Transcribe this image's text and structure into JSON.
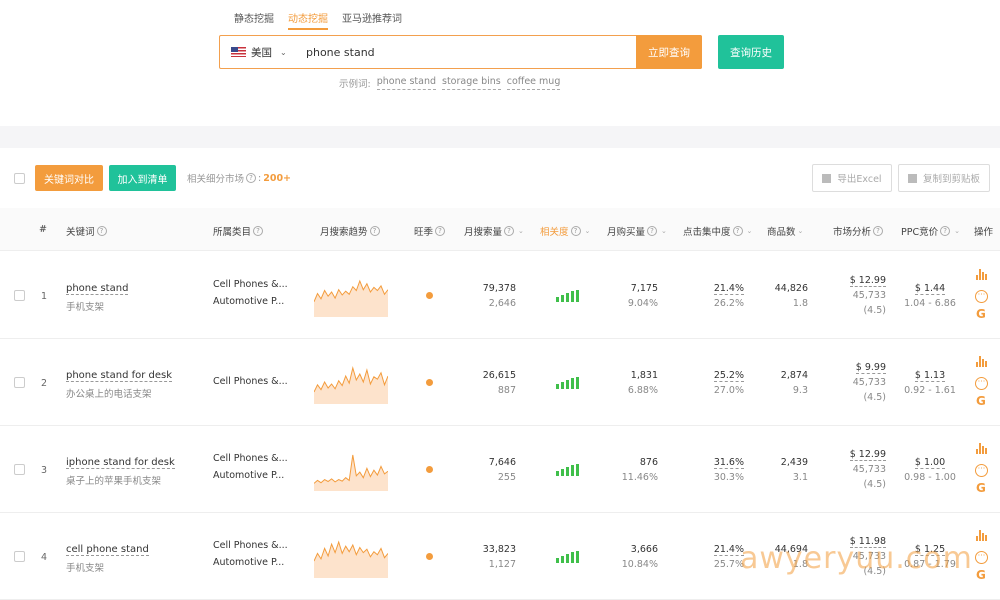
{
  "tabs": [
    "静态挖掘",
    "动态挖掘",
    "亚马逊推荐词"
  ],
  "search": {
    "country": "美国",
    "keyword": "phone stand",
    "search_button": "立即查询",
    "history_button": "查询历史",
    "examples_label": "示例词:",
    "examples": [
      "phone stand",
      "storage bins",
      "coffee mug"
    ]
  },
  "toolbar": {
    "compare_button": "关键词对比",
    "add_list_button": "加入到清单",
    "market_label": "相关细分市场",
    "market_count": "200+",
    "export_button": "导出Excel",
    "copy_button": "复制到剪贴板"
  },
  "table": {
    "headers": [
      "#",
      "关键词",
      "所属类目",
      "月搜索趋势",
      "旺季",
      "月搜索量",
      "相关度",
      "月购买量",
      "点击集中度",
      "商品数",
      "市场分析",
      "PPC竞价",
      "操作"
    ],
    "rows": [
      {
        "index": "1",
        "keyword": "phone stand",
        "keyword_cn": "手机支架",
        "cat1": "Cell Phones &...",
        "cat2": "Automotive P...",
        "search_vol": "79,378",
        "search_vol_sub": "2,646",
        "relevance": 5,
        "purchase": "7,175",
        "purchase_rate": "9.04%",
        "click": "21.4%",
        "click_sub": "26.2%",
        "products": "44,826",
        "products_sub": "1.8",
        "price": "$ 12.99",
        "reviews": "45,733",
        "rating": "(4.5)",
        "ppc": "$ 1.44",
        "ppc_range": "1.04 - 6.86",
        "trend": [
          40,
          62,
          48,
          70,
          55,
          66,
          50,
          72,
          58,
          68,
          60,
          80,
          70,
          95,
          72,
          88,
          66,
          78,
          70,
          82,
          60,
          72
        ]
      },
      {
        "index": "2",
        "keyword": "phone stand for desk",
        "keyword_cn": "办公桌上的电话支架",
        "cat1": "Cell Phones &...",
        "cat2": "",
        "search_vol": "26,615",
        "search_vol_sub": "887",
        "relevance": 5,
        "purchase": "1,831",
        "purchase_rate": "6.88%",
        "click": "25.2%",
        "click_sub": "27.0%",
        "products": "2,874",
        "products_sub": "9.3",
        "price": "$ 9.99",
        "reviews": "45,733",
        "rating": "(4.5)",
        "ppc": "$ 1.13",
        "ppc_range": "0.92 - 1.61",
        "trend": [
          30,
          48,
          36,
          55,
          40,
          50,
          38,
          58,
          46,
          70,
          52,
          90,
          60,
          75,
          55,
          85,
          50,
          68,
          62,
          78,
          48,
          70
        ]
      },
      {
        "index": "3",
        "keyword": "iphone stand for desk",
        "keyword_cn": "桌子上的苹果手机支架",
        "cat1": "Cell Phones &...",
        "cat2": "Automotive P...",
        "search_vol": "7,646",
        "search_vol_sub": "255",
        "relevance": 5,
        "purchase": "876",
        "purchase_rate": "11.46%",
        "click": "31.6%",
        "click_sub": "30.3%",
        "products": "2,439",
        "products_sub": "3.1",
        "price": "$ 12.99",
        "reviews": "45,733",
        "rating": "(4.5)",
        "ppc": "$ 1.00",
        "ppc_range": "0.98 - 1.00",
        "trend": [
          20,
          28,
          22,
          30,
          25,
          32,
          24,
          30,
          26,
          35,
          28,
          95,
          40,
          50,
          35,
          60,
          38,
          55,
          42,
          65,
          45,
          52
        ]
      },
      {
        "index": "4",
        "keyword": "cell phone stand",
        "keyword_cn": "手机支架",
        "cat1": "Cell Phones &...",
        "cat2": "Automotive P...",
        "search_vol": "33,823",
        "search_vol_sub": "1,127",
        "relevance": 5,
        "purchase": "3,666",
        "purchase_rate": "10.84%",
        "click": "21.4%",
        "click_sub": "25.7%",
        "products": "44,694",
        "products_sub": "1.8",
        "price": "$ 11.98",
        "reviews": "45,733",
        "rating": "(4.5)",
        "ppc": "$ 1.25",
        "ppc_range": "0.87 - 1.79",
        "trend": [
          40,
          58,
          45,
          70,
          52,
          80,
          60,
          85,
          58,
          75,
          62,
          78,
          55,
          72,
          60,
          68,
          50,
          62,
          55,
          70,
          48,
          58
        ]
      }
    ]
  },
  "watermark": "awyeryuu.com",
  "colors": {
    "accent": "#f39c3d",
    "green": "#20c29a",
    "signal": "#3fbf4a"
  }
}
